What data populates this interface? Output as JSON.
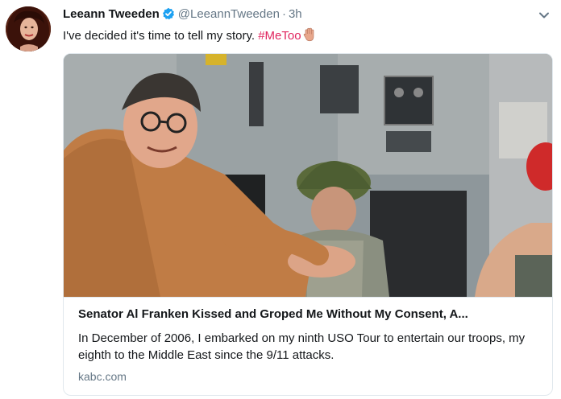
{
  "tweet": {
    "display_name": "Leeann Tweeden",
    "handle": "@LeeannTweeden",
    "separator": "·",
    "time": "3h",
    "text": "I've decided it's time to tell my story.",
    "hashtag": "#MeToo",
    "verified_icon": "verified-badge-icon",
    "emoji_icon": "raised-hand-emoji-icon",
    "more_icon": "chevron-down-icon"
  },
  "card": {
    "title": "Senator Al Franken Kissed and Groped Me Without My Consent, A...",
    "description": "In December of 2006, I embarked on my ninth USO Tour to entertain our troops, my eighth to the Middle East since the 9/11 attacks.",
    "domain": "kabc.com"
  },
  "colors": {
    "hashtag": "#e0245e",
    "verified": "#1da1f2",
    "secondary_text": "#657786",
    "border": "#e1e8ed"
  }
}
